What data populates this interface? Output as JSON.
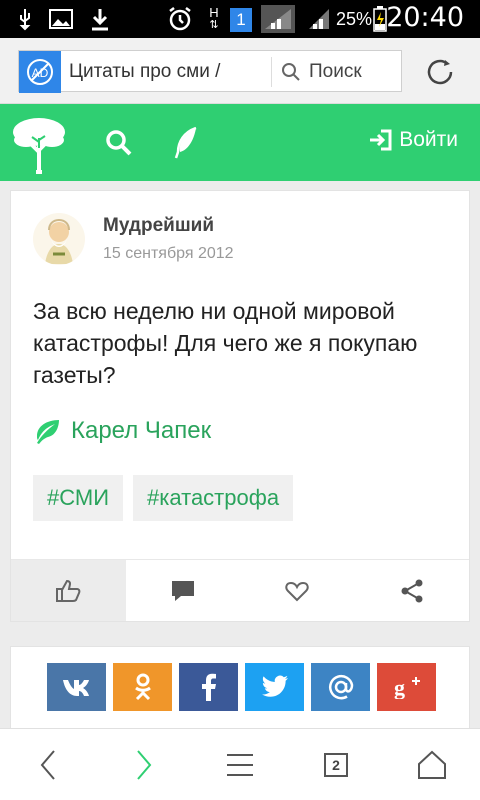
{
  "status_bar": {
    "battery_percent": "25%",
    "time": "20:40",
    "notification_count": "1",
    "network_label": "H"
  },
  "browser": {
    "url": "Цитаты про сми /",
    "search_placeholder": "Поиск",
    "adblock_label": "AD",
    "tabs_count": "2"
  },
  "header": {
    "login_label": "Войти"
  },
  "post": {
    "author": "Мудрейший",
    "date": "15 сентября 2012",
    "quote": "За всю неделю ни одной мировой катастрофы! Для чего же я покупаю газеты?",
    "source": "Карел Чапек",
    "tags": [
      "#СМИ",
      "#катастрофа"
    ]
  },
  "share": {
    "buttons": [
      {
        "name": "vk",
        "label": "вк",
        "color": "#4a76a8"
      },
      {
        "name": "odnoklassniki",
        "label": "ок",
        "color": "#f0962a"
      },
      {
        "name": "facebook",
        "label": "f",
        "color": "#3b5998"
      },
      {
        "name": "twitter",
        "label": "twitter",
        "color": "#1da1f2"
      },
      {
        "name": "mail",
        "label": "@",
        "color": "#3d84c4"
      },
      {
        "name": "google-plus",
        "label": "g+",
        "color": "#dd4b39"
      }
    ]
  },
  "colors": {
    "brand_green": "#2fcf72",
    "link_green": "#2aa35c",
    "adblock_blue": "#2f86e8"
  }
}
